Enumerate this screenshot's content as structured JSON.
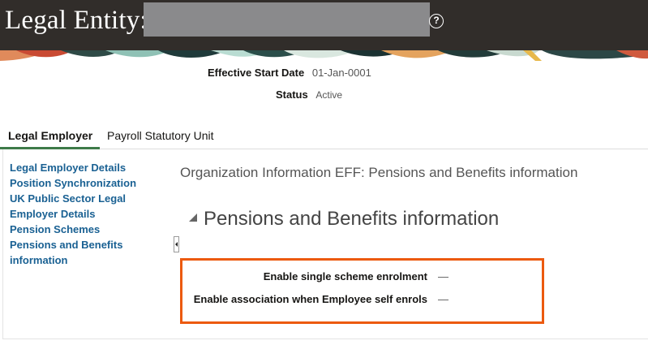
{
  "header": {
    "title_prefix": "Legal Entity:",
    "help_icon": "question-circle-icon",
    "help_symbol": "?"
  },
  "summary": {
    "effective_start_date_label": "Effective Start Date",
    "effective_start_date_value": "01-Jan-0001",
    "status_label": "Status",
    "status_value": "Active"
  },
  "tabs": [
    {
      "label": "Legal Employer",
      "active": true
    },
    {
      "label": "Payroll Statutory Unit",
      "active": false
    }
  ],
  "sidenav": {
    "items": [
      {
        "label": "Legal Employer Details"
      },
      {
        "label": "Position Synchronization"
      },
      {
        "label": "UK Public Sector Legal Employer Details"
      },
      {
        "label": "Pension Schemes"
      },
      {
        "label": "Pensions and Benefits information"
      }
    ]
  },
  "content": {
    "title": "Organization Information EFF: Pensions and Benefits information",
    "section_title": "Pensions and Benefits information",
    "fields": [
      {
        "label": "Enable single scheme enrolment",
        "value": "—"
      },
      {
        "label": "Enable association when Employee self enrols",
        "value": "—"
      }
    ]
  },
  "colors": {
    "header_bg": "#312d2a",
    "link": "#1a6193",
    "tab_active_underline": "#3e7b49",
    "highlight_border": "#ec5a0f"
  }
}
